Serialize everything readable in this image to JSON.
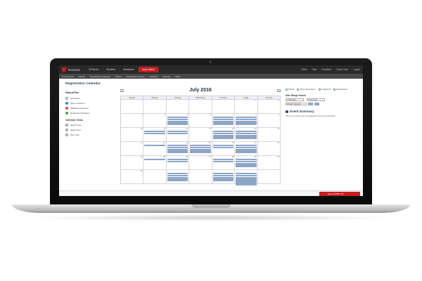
{
  "app": {
    "logo": "Kenexa"
  },
  "nav": {
    "items": [
      "MYWorks",
      "Workflow",
      "Assistance",
      "Learn Admin"
    ],
    "active_index": 3,
    "utility": [
      "Alerts",
      "Help",
      "Feedback",
      "Switch User",
      "Logout"
    ]
  },
  "subnav": [
    "Learn Home",
    "Search",
    "Registration Calendar",
    "Admin",
    "Registration Queue",
    "Calendar",
    "Reports",
    "Mass"
  ],
  "page": {
    "title": "Registration Calendar"
  },
  "filters": {
    "header": "Status/Filter",
    "items": [
      {
        "label": "Selections",
        "type": "checkbox",
        "color": "#8aa0c0"
      },
      {
        "label": "Open Sessions",
        "type": "dot",
        "color": "#3b7dd8"
      },
      {
        "label": "Waitlisted Sessions",
        "type": "dot",
        "color": "#d64545"
      },
      {
        "label": "Registered Sessions",
        "type": "dot",
        "color": "#3aa655"
      }
    ],
    "calendar_views_header": "Calendar Views",
    "views": [
      "Month View",
      "Week View",
      "Day View"
    ]
  },
  "calendar": {
    "month_label": "July 2016",
    "prev": "<",
    "next": ">",
    "weekdays": [
      "Sunday",
      "Monday",
      "Tuesday",
      "Wednesday",
      "Thursday",
      "Friday",
      "Saturday"
    ],
    "weeks": [
      [
        {
          "d": ""
        },
        {
          "d": ""
        },
        {
          "d": ""
        },
        {
          "d": ""
        },
        {
          "d": ""
        },
        {
          "d": "1"
        },
        {
          "d": "2"
        }
      ],
      [
        {
          "d": "3"
        },
        {
          "d": "4"
        },
        {
          "d": "5",
          "ev": 4
        },
        {
          "d": "6"
        },
        {
          "d": "7",
          "ev": 4
        },
        {
          "d": "8",
          "ev": 4
        },
        {
          "d": "9"
        }
      ],
      [
        {
          "d": "10"
        },
        {
          "d": "11",
          "ev": 2
        },
        {
          "d": "12",
          "ev": 2
        },
        {
          "d": "13"
        },
        {
          "d": "14",
          "ev": 4
        },
        {
          "d": "15",
          "ev": 4
        },
        {
          "d": "16"
        }
      ],
      [
        {
          "d": "17"
        },
        {
          "d": "18",
          "ev": 1
        },
        {
          "d": "19",
          "ev": 4
        },
        {
          "d": "20",
          "ev": 4
        },
        {
          "d": "21",
          "ev": 2
        },
        {
          "d": "22",
          "ev": 4
        },
        {
          "d": "23"
        }
      ],
      [
        {
          "d": "24"
        },
        {
          "d": "25",
          "ev": 1
        },
        {
          "d": "26",
          "ev": 2
        },
        {
          "d": "27"
        },
        {
          "d": "28",
          "ev": 2
        },
        {
          "d": "29",
          "ev": 4
        },
        {
          "d": "30"
        }
      ],
      [
        {
          "d": "31"
        },
        {
          "d": ""
        },
        {
          "d": "",
          "ev": 4
        },
        {
          "d": ""
        },
        {
          "d": "",
          "ev": 4
        },
        {
          "d": "",
          "ev": 6
        },
        {
          "d": ""
        }
      ]
    ]
  },
  "sidebar": {
    "views": [
      "Month",
      "Show Selections",
      "Collapsed",
      "All Sessions"
    ],
    "date_range_title": "Date Range Search",
    "from_value": "07/01/2016",
    "to_value": "07/31/2016",
    "select_value": "Weekly Calendar",
    "summary_title": "Event Summary",
    "summary_text": "Click on an event to see the registration summary and details."
  },
  "footer": {
    "button": "Save & PRINT (0)"
  },
  "colors": {
    "accent": "#c41f1f",
    "event": "#8ea6c6",
    "title": "#2f3e55"
  }
}
